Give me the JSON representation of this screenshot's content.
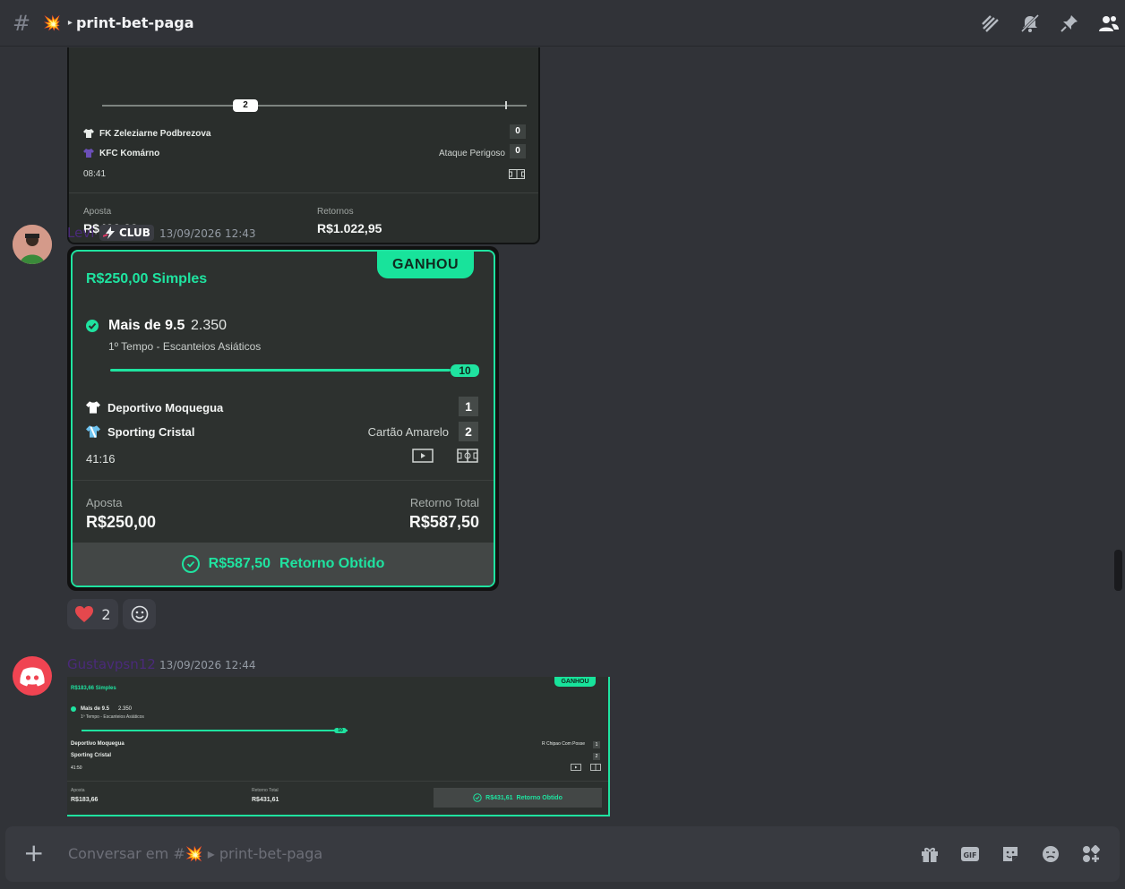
{
  "header": {
    "channel_prefix": "#",
    "channel_emoji": "💥",
    "channel_arrow": "▸",
    "channel_name": "print-bet-paga",
    "icons": [
      "threads-icon",
      "mute-notifications-icon",
      "pin-icon",
      "members-icon"
    ]
  },
  "old_bet": {
    "progress_value": "2",
    "team1": "FK Zeleziarne Podbrezova",
    "team1_score": "0",
    "team2": "KFC Komárno",
    "team2_score": "0",
    "event": "Ataque Perigoso",
    "clock": "08:41",
    "stake_label": "Aposta",
    "stake_value": "R$499,00",
    "return_label": "Retornos",
    "return_value": "R$1.022,95"
  },
  "message1": {
    "author": "Levi",
    "badge": "CLUB",
    "time": "13/09/2026 12:43",
    "bet": {
      "status": "GANHOU",
      "title": "R$250,00  Simples",
      "market": "Mais de 9.5",
      "odd": "2.350",
      "market_sub": "1º Tempo - Escanteios Asiáticos",
      "progress_value": "10",
      "team1": "Deportivo Moquegua",
      "team1_score": "1",
      "team2": "Sporting Cristal",
      "team2_score": "2",
      "event": "Cartão Amarelo",
      "clock": "41:16",
      "stake_label": "Aposta",
      "stake_value": "R$250,00",
      "return_label": "Retorno Total",
      "return_value": "R$587,50",
      "footer_amount": "R$587,50",
      "footer_text": "Retorno Obtido"
    },
    "reactions": [
      {
        "emoji": "heart",
        "count": "2"
      }
    ]
  },
  "message2": {
    "author": "Gustavpsn12",
    "time": "13/09/2026 12:44",
    "bet": {
      "status": "GANHOU",
      "title": "R$183,66  Simples",
      "market": "Mais de 9.5",
      "odd": "2.350",
      "market_sub": "1º Tempo - Escanteios Asiáticos",
      "progress_value": "10",
      "team1": "Deportivo Moquegua",
      "team1_score": "1",
      "team2": "Sporting Cristal",
      "team2_score": "2",
      "event": "R Chipao Com Posse",
      "clock": "41:50",
      "stake_label": "Aposta",
      "stake_value": "R$183,66",
      "return_label": "Retorno Total",
      "return_value": "R$431,61",
      "footer_amount": "R$431,61",
      "footer_text": "Retorno Obtido"
    }
  },
  "composer": {
    "placeholder": "Conversar em #💥 ▸ print-bet-paga",
    "icons": [
      "gift-icon",
      "gif-icon",
      "sticker-icon",
      "emoji-icon",
      "apps-icon"
    ]
  },
  "colors": {
    "accent": "#1fe3a0",
    "background": "#313338",
    "heart": "#e5484d"
  }
}
